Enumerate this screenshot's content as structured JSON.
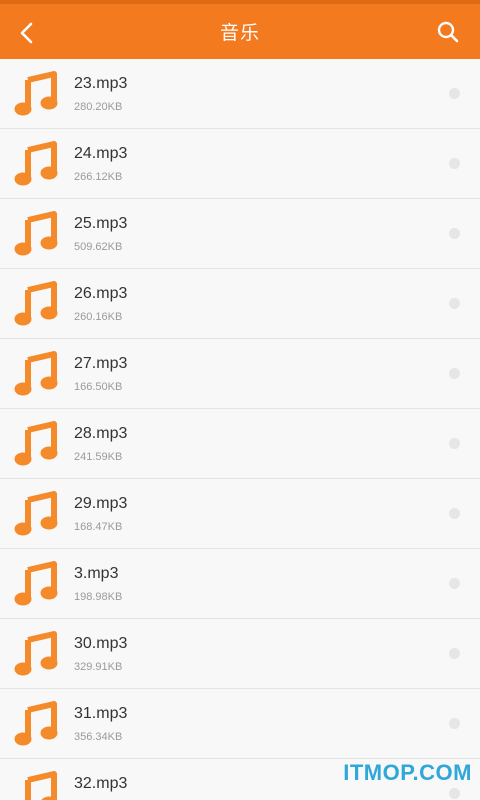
{
  "header": {
    "title": "音乐",
    "back_icon": "chevron-left-icon",
    "search_icon": "search-icon",
    "bar_color": "#f47a20"
  },
  "files": [
    {
      "name": "23.mp3",
      "size": "280.20KB"
    },
    {
      "name": "24.mp3",
      "size": "266.12KB"
    },
    {
      "name": "25.mp3",
      "size": "509.62KB"
    },
    {
      "name": "26.mp3",
      "size": "260.16KB"
    },
    {
      "name": "27.mp3",
      "size": "166.50KB"
    },
    {
      "name": "28.mp3",
      "size": "241.59KB"
    },
    {
      "name": "29.mp3",
      "size": "168.47KB"
    },
    {
      "name": "3.mp3",
      "size": "198.98KB"
    },
    {
      "name": "30.mp3",
      "size": "329.91KB"
    },
    {
      "name": "31.mp3",
      "size": "356.34KB"
    },
    {
      "name": "32.mp3",
      "size": ""
    }
  ],
  "file_icon": "music-note-icon",
  "note_color": "#f48a2a",
  "watermark": "ITMOP.COM"
}
